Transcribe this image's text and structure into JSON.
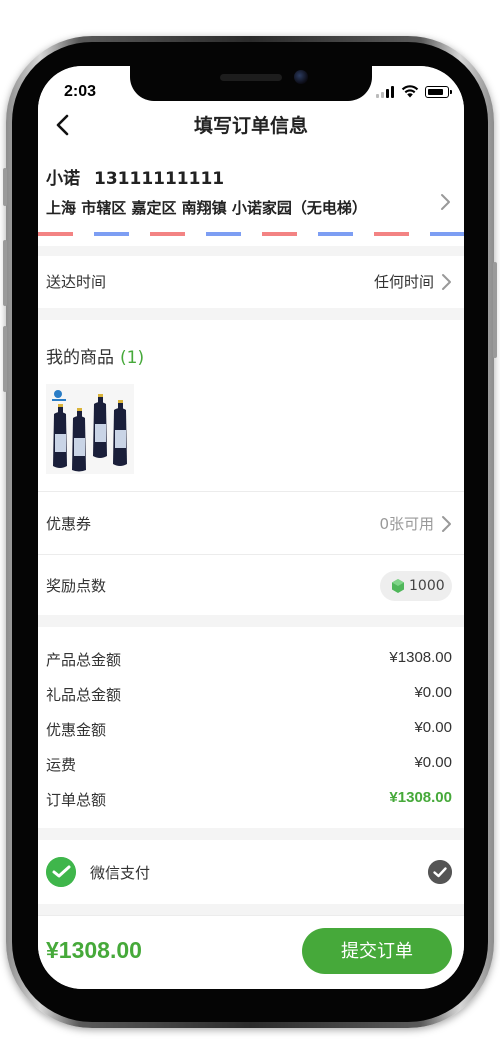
{
  "status": {
    "time": "2:03"
  },
  "nav": {
    "title": "填写订单信息"
  },
  "address": {
    "name": "小诺",
    "phone": "13111111111",
    "detail": "上海 市辖区 嘉定区 南翔镇 小诺家园（无电梯）"
  },
  "delivery": {
    "label": "送达时间",
    "value": "任何时间"
  },
  "goods": {
    "title": "我的商品",
    "count": "(1)"
  },
  "coupon": {
    "label": "优惠券",
    "value": "0张可用"
  },
  "points": {
    "label": "奖励点数",
    "value": "1000"
  },
  "summary": {
    "product_total_label": "产品总金额",
    "product_total": "¥1308.00",
    "gift_total_label": "礼品总金额",
    "gift_total": "¥0.00",
    "discount_label": "优惠金额",
    "discount": "¥0.00",
    "shipping_label": "运费",
    "shipping": "¥0.00",
    "order_total_label": "订单总额",
    "order_total": "¥1308.00"
  },
  "payment": {
    "label": "微信支付"
  },
  "bottom": {
    "total": "¥1308.00",
    "submit_label": "提交订单"
  },
  "colors": {
    "accent": "#46a93a",
    "stripe_red": "#f38383",
    "stripe_blue": "#7d9ef3"
  }
}
